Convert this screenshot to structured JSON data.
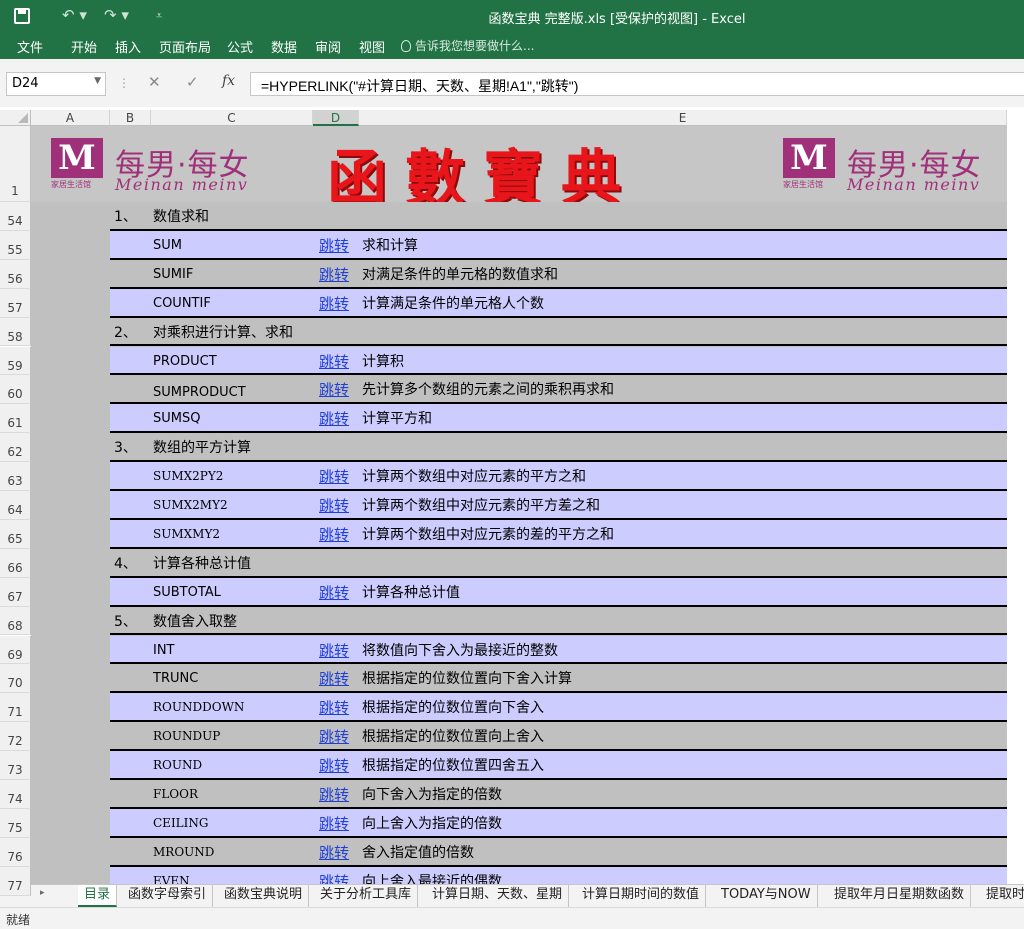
{
  "window": {
    "title": "函数宝典 完整版.xls  [受保护的视图] - Excel"
  },
  "ribbon": {
    "tabs": [
      "文件",
      "开始",
      "插入",
      "页面布局",
      "公式",
      "数据",
      "审阅",
      "视图"
    ],
    "tell_me": "告诉我您想要做什么..."
  },
  "formula_bar": {
    "name_box": "D24",
    "fx": "fx",
    "formula": "=HYPERLINK(\"#计算日期、天数、星期!A1\",\"跳转\")"
  },
  "columns": [
    "A",
    "B",
    "C",
    "D",
    "E"
  ],
  "banner": {
    "brand_cn": "每男·每女",
    "brand_en": "Meinan meinv",
    "logo_letter": "M",
    "logo_sub": "家居生活馆",
    "title": "函數寶典"
  },
  "rows": [
    {
      "row": "54",
      "kind": "section",
      "num": "1、",
      "name": "数值求和"
    },
    {
      "row": "55",
      "kind": "item",
      "func": "SUM",
      "link": "跳转",
      "desc": "求和计算"
    },
    {
      "row": "56",
      "kind": "item",
      "func": "SUMIF",
      "link": "跳转",
      "desc": "对满足条件的单元格的数值求和"
    },
    {
      "row": "57",
      "kind": "item",
      "func": "COUNTIF",
      "link": "跳转",
      "desc": "计算满足条件的单元格人个数"
    },
    {
      "row": "58",
      "kind": "section",
      "num": "2、",
      "name": "对乘积进行计算、求和"
    },
    {
      "row": "59",
      "kind": "item",
      "func": "PRODUCT",
      "link": "跳转",
      "desc": "计算积"
    },
    {
      "row": "60",
      "kind": "item",
      "func": "SUMPRODUCT",
      "link": "跳转",
      "desc": "先计算多个数组的元素之间的乘积再求和"
    },
    {
      "row": "61",
      "kind": "item",
      "func": "SUMSQ",
      "link": "跳转",
      "desc": "计算平方和"
    },
    {
      "row": "62",
      "kind": "section",
      "num": "3、",
      "name": "数组的平方计算"
    },
    {
      "row": "63",
      "kind": "item",
      "func": "SUMX2PY2",
      "link": "跳转",
      "desc": "计算两个数组中对应元素的平方之和"
    },
    {
      "row": "64",
      "kind": "item",
      "func": "SUMX2MY2",
      "link": "跳转",
      "desc": "计算两个数组中对应元素的平方差之和"
    },
    {
      "row": "65",
      "kind": "item",
      "func": "SUMXMY2",
      "link": "跳转",
      "desc": "计算两个数组中对应元素的差的平方之和"
    },
    {
      "row": "66",
      "kind": "section",
      "num": "4、",
      "name": "计算各种总计值"
    },
    {
      "row": "67",
      "kind": "item",
      "func": "SUBTOTAL",
      "link": "跳转",
      "desc": "计算各种总计值"
    },
    {
      "row": "68",
      "kind": "section",
      "num": "5、",
      "name": "数值舍入取整"
    },
    {
      "row": "69",
      "kind": "item",
      "func": "INT",
      "link": "跳转",
      "desc": "将数值向下舍入为最接近的整数"
    },
    {
      "row": "70",
      "kind": "item",
      "func": "TRUNC",
      "link": "跳转",
      "desc": "根据指定的位数位置向下舍入计算"
    },
    {
      "row": "71",
      "kind": "item",
      "func": "ROUNDDOWN",
      "link": "跳转",
      "desc": "根据指定的位数位置向下舍入"
    },
    {
      "row": "72",
      "kind": "item",
      "func": "ROUNDUP",
      "link": "跳转",
      "desc": "根据指定的位数位置向上舍入"
    },
    {
      "row": "73",
      "kind": "item",
      "func": "ROUND",
      "link": "跳转",
      "desc": "根据指定的位数位置四舍五入"
    },
    {
      "row": "74",
      "kind": "item",
      "func": "FLOOR",
      "link": "跳转",
      "desc": "向下舍入为指定的倍数"
    },
    {
      "row": "75",
      "kind": "item",
      "func": "CEILING",
      "link": "跳转",
      "desc": "向上舍入为指定的倍数"
    },
    {
      "row": "76",
      "kind": "item",
      "func": "MROUND",
      "link": "跳转",
      "desc": "舍入指定值的倍数"
    },
    {
      "row": "77",
      "kind": "item",
      "func": "EVEN",
      "link": "跳转",
      "desc": "向上舍入最接近的偶数"
    }
  ],
  "sheet_tabs": [
    "目录",
    "函数字母索引",
    "函数宝典说明",
    "关于分析工具库",
    "计算日期、天数、星期",
    "计算日期时间的数值",
    "TODAY与NOW",
    "提取年月日星期数函数",
    "提取时"
  ],
  "status": "就绪"
}
